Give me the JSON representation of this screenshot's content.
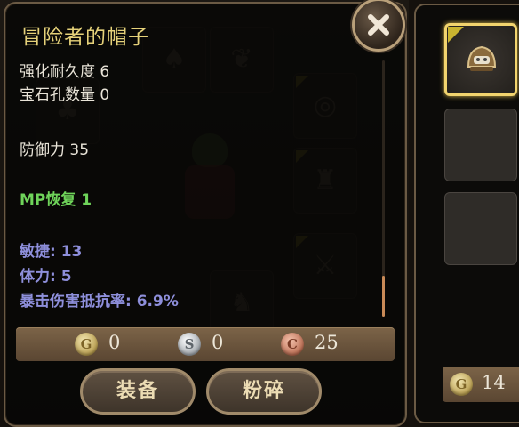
{
  "item": {
    "name": "冒险者的帽子",
    "stats": {
      "enhance_durability": "强化耐久度 6",
      "gem_slots": "宝石孔数量 0",
      "defense": "防御力 35",
      "mp_recovery": "MP恢复 1",
      "agility": "敏捷: 13",
      "stamina": "体力: 5",
      "crit_resist": "暴击伤害抵抗率: 6.9%"
    }
  },
  "price": {
    "gold": "0",
    "silver": "0",
    "copper": "25"
  },
  "coin_letters": {
    "gold": "G",
    "silver": "S",
    "copper": "C"
  },
  "actions": {
    "equip_label": "装备",
    "shatter_label": "粉碎"
  },
  "side_panel": {
    "gold_count": "14"
  },
  "colors": {
    "title": "#e6d27a",
    "stat_green": "#6fd45a",
    "stat_blue": "#8e8fdb",
    "frame": "#6b5a44",
    "selected_border": "#f2d46e"
  },
  "icons": [
    "close-icon",
    "gold-coin-icon",
    "silver-coin-icon",
    "copper-coin-icon",
    "helmet-icon"
  ]
}
